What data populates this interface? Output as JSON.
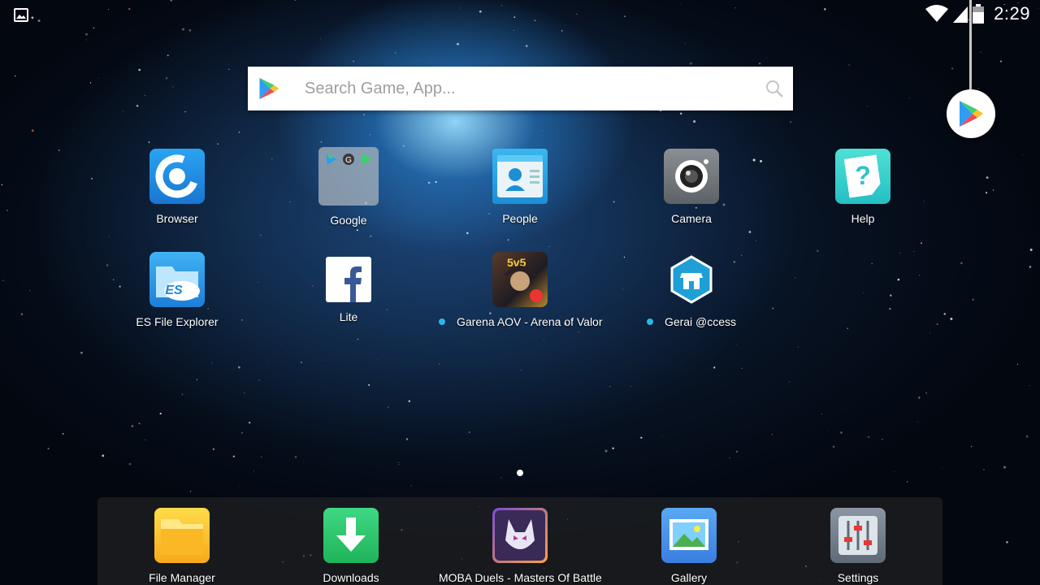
{
  "status_bar": {
    "time": "2:29",
    "icons": [
      "gallery-notification-icon",
      "wifi-icon",
      "signal-icon",
      "battery-icon"
    ]
  },
  "search": {
    "placeholder": "Search Game, App...",
    "value": ""
  },
  "float_button": {
    "icon": "play-store-icon"
  },
  "home_apps": [
    {
      "label": "Browser",
      "icon": "browser-icon"
    },
    {
      "label": "Google",
      "icon": "google-folder-icon"
    },
    {
      "label": "People",
      "icon": "people-icon"
    },
    {
      "label": "Camera",
      "icon": "camera-icon"
    },
    {
      "label": "Help",
      "icon": "help-icon"
    },
    {
      "label": "ES File Explorer",
      "icon": "es-file-explorer-icon"
    },
    {
      "label": "Lite",
      "icon": "facebook-lite-icon"
    },
    {
      "label": "Garena AOV - Arena of Valor",
      "icon": "garena-aov-icon",
      "new": true
    },
    {
      "label": "Gerai @ccess",
      "icon": "gerai-access-icon",
      "new": true
    }
  ],
  "page_indicator": {
    "current": 1,
    "total": 1
  },
  "dock_apps": [
    {
      "label": "File Manager",
      "icon": "file-manager-icon"
    },
    {
      "label": "Downloads",
      "icon": "downloads-icon"
    },
    {
      "label": "MOBA Duels - Masters Of Battle",
      "icon": "moba-duels-icon"
    },
    {
      "label": "Gallery",
      "icon": "gallery-icon"
    },
    {
      "label": "Settings",
      "icon": "settings-icon"
    }
  ],
  "colors": {
    "accent_blue": "#2bb6e8",
    "new_app_dot": "#2bb6e8"
  }
}
